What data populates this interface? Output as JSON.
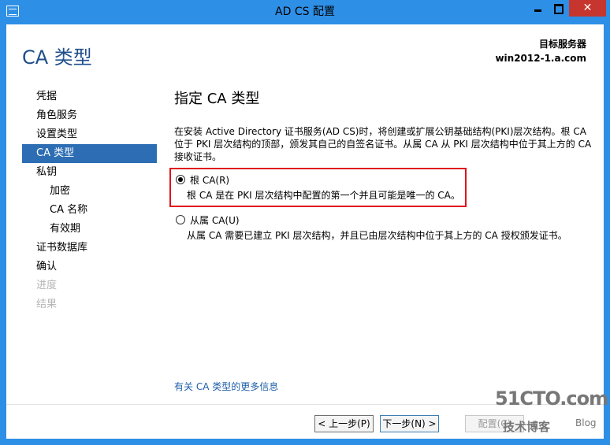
{
  "window": {
    "title": "AD CS 配置"
  },
  "header": {
    "page_title": "CA 类型",
    "server_label": "目标服务器",
    "server_name": "win2012-1.a.com"
  },
  "nav": {
    "items": [
      {
        "label": "凭据"
      },
      {
        "label": "角色服务"
      },
      {
        "label": "设置类型"
      },
      {
        "label": "CA 类型"
      },
      {
        "label": "私钥"
      },
      {
        "label": "加密"
      },
      {
        "label": "CA 名称"
      },
      {
        "label": "有效期"
      },
      {
        "label": "证书数据库"
      },
      {
        "label": "确认"
      },
      {
        "label": "进度"
      },
      {
        "label": "结果"
      }
    ]
  },
  "main": {
    "heading": "指定 CA 类型",
    "description": "在安装 Active Directory 证书服务(AD CS)时，将创建或扩展公钥基础结构(PKI)层次结构。根 CA 位于 PKI 层次结构的顶部，颁发其自己的自签名证书。从属 CA 从 PKI 层次结构中位于其上方的 CA 接收证书。",
    "options": [
      {
        "label": "根 CA(R)",
        "desc": "根 CA 是在 PKI 层次结构中配置的第一个并且可能是唯一的 CA。",
        "selected": true
      },
      {
        "label": "从属 CA(U)",
        "desc": "从属 CA 需要已建立 PKI 层次结构，并且已由层次结构中位于其上方的 CA 授权颁发证书。",
        "selected": false
      }
    ],
    "more_link": "有关 CA 类型的更多信息"
  },
  "buttons": {
    "prev": "< 上一步(P)",
    "next": "下一步(N) >",
    "configure": "配置(C)"
  },
  "watermark": {
    "line1": "51CTO.com",
    "line2": "技术博客",
    "line3": "Blog"
  },
  "colors": {
    "frame": "#2e8fe6",
    "close": "#c7352f",
    "nav_active": "#2d6db3",
    "highlight": "#e0121d",
    "title": "#1f4e8c",
    "link": "#1f5fa8"
  }
}
